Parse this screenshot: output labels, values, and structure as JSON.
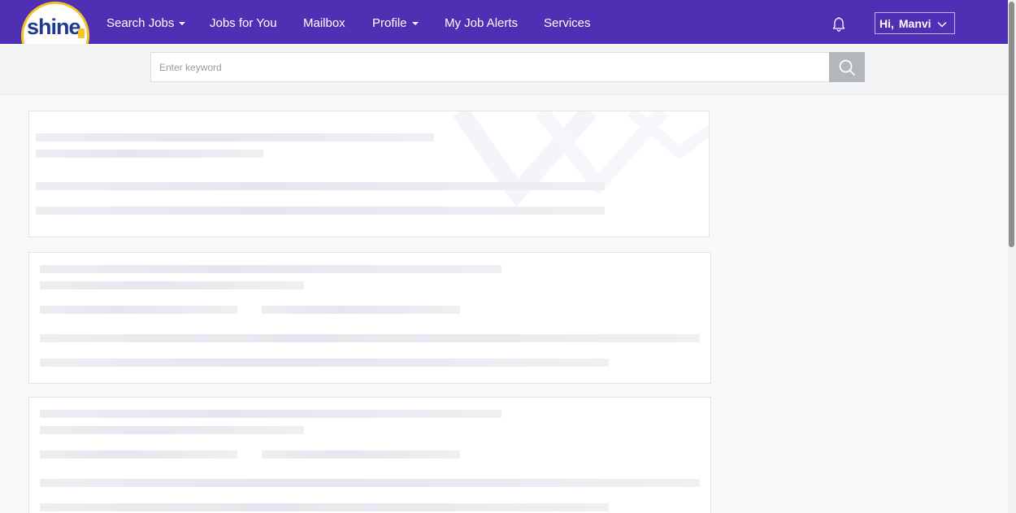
{
  "header": {
    "logo_text": "shine",
    "nav": [
      {
        "label": "Search Jobs",
        "has_caret": true
      },
      {
        "label": "Jobs for You",
        "has_caret": false
      },
      {
        "label": "Mailbox",
        "has_caret": false
      },
      {
        "label": "Profile",
        "has_caret": true
      },
      {
        "label": "My Job Alerts",
        "has_caret": false
      },
      {
        "label": "Services",
        "has_caret": false
      }
    ],
    "greeting": "Hi,",
    "user_name": "Manvi",
    "icons": {
      "notifications": "bell-icon",
      "user_menu": "chevron-down-icon",
      "search": "search-icon"
    }
  },
  "search": {
    "placeholder": "Enter keyword",
    "value": ""
  },
  "colors": {
    "header_bg": "#4f30b4",
    "logo_ring": "#f6c326",
    "logo_text": "#1f3b8f",
    "search_button": "#b3b6bb",
    "page_bg": "#f9f9fa"
  },
  "main": {
    "state": "loading",
    "skeleton_cards": 3
  }
}
